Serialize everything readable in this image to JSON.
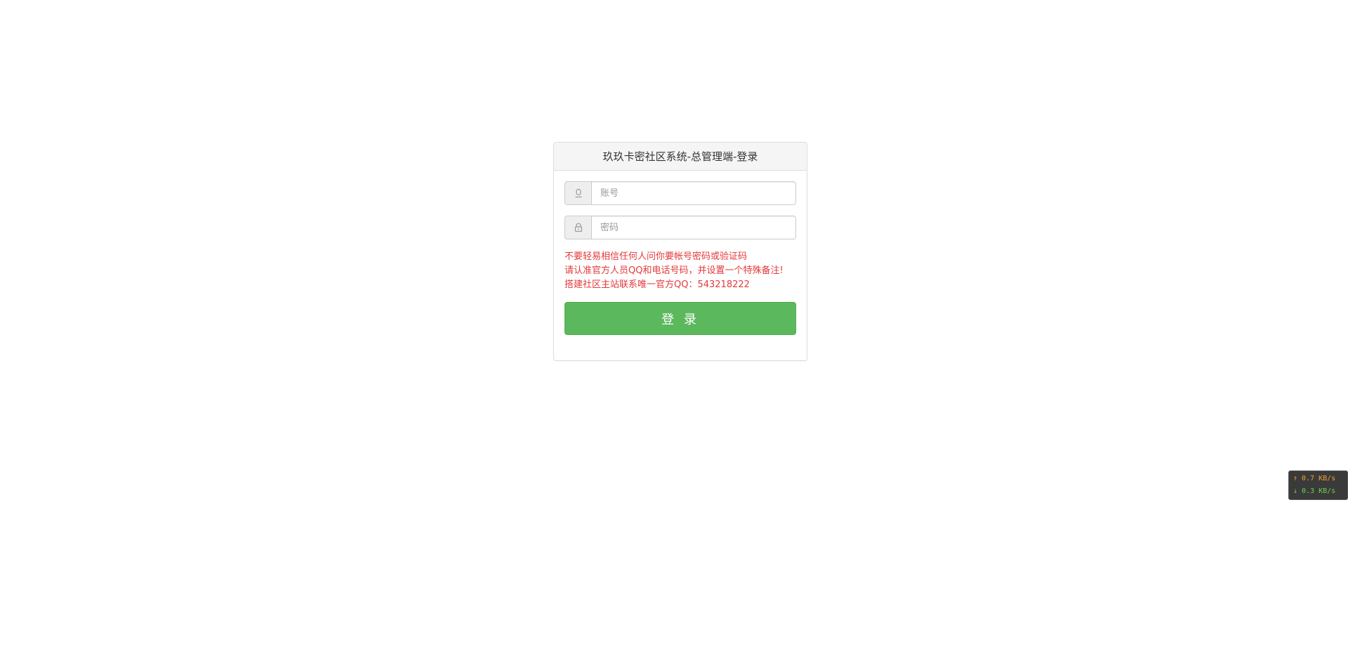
{
  "panel": {
    "title": "玖玖卡密社区系统-总管理端-登录"
  },
  "form": {
    "account": {
      "placeholder": "账号",
      "value": "",
      "icon": "user-icon"
    },
    "password": {
      "placeholder": "密码",
      "value": "",
      "icon": "lock-icon"
    },
    "notice_lines": [
      "不要轻易相信任何人问你要帐号密码或验证码",
      "请认准官方人员QQ和电话号码，并设置一个特殊备注!",
      "搭建社区主站联系唯一官方QQ：543218222"
    ],
    "login_label": "登 录"
  },
  "speed_widget": {
    "upload": "↑ 0.7 KB/s",
    "download": "↓ 0.3 KB/s"
  },
  "colors": {
    "notice": "#e4393c",
    "button": "#5cb85c",
    "heading_bg": "#f5f5f5"
  }
}
